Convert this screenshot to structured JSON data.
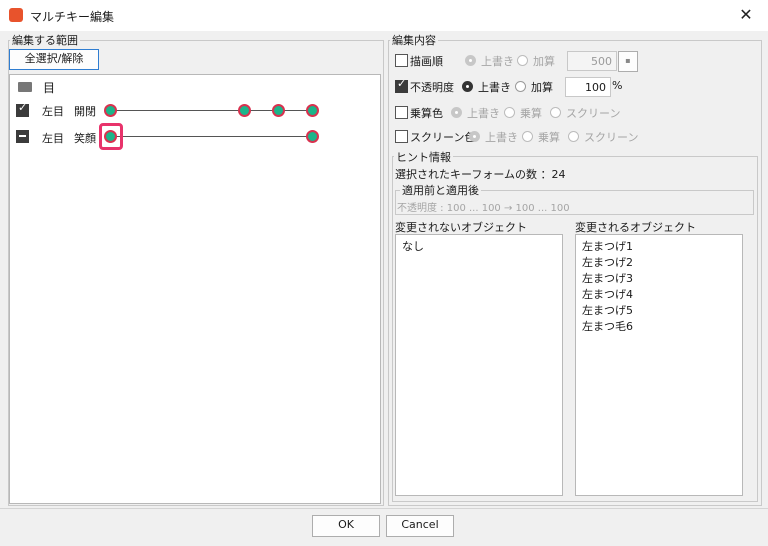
{
  "window": {
    "title": "マルチキー編集",
    "close_glyph": "✕",
    "accent": "#e8532c"
  },
  "left": {
    "legend": "編集する範囲",
    "select_all_label": "全選択/解除",
    "folder_label": "目",
    "rows": [
      {
        "part": "左目",
        "param": "開閉"
      },
      {
        "part": "左目",
        "param": "笑顔"
      }
    ]
  },
  "edit": {
    "legend": "編集内容",
    "draw_order": {
      "label": "描画順",
      "overwrite": "上書き",
      "add": "加算",
      "value": "500",
      "spin_glyph": "▪"
    },
    "opacity": {
      "label": "不透明度",
      "overwrite": "上書き",
      "add": "加算",
      "value": "100",
      "unit": "%"
    },
    "multiply": {
      "label": "乗算色",
      "overwrite": "上書き",
      "multiply": "乗算",
      "screen": "スクリーン"
    },
    "screen": {
      "label": "スクリーン色",
      "overwrite": "上書き",
      "multiply": "乗算",
      "screen": "スクリーン"
    }
  },
  "hint": {
    "legend": "ヒント情報",
    "count_text": "選択されたキーフォームの数 ：24",
    "before_after_legend": "適用前と適用後",
    "before_after_text": "不透明度 : 100 ... 100 → 100 ... 100",
    "unchanged_header": "変更されないオブジェクト",
    "changed_header": "変更されるオブジェクト",
    "unchanged_items": [
      "なし"
    ],
    "changed_items": [
      "左まつげ1",
      "左まつげ2",
      "左まつげ3",
      "左まつげ4",
      "左まつげ5",
      "左まつ毛6"
    ]
  },
  "footer": {
    "ok_label": "OK",
    "cancel_label": "Cancel"
  }
}
